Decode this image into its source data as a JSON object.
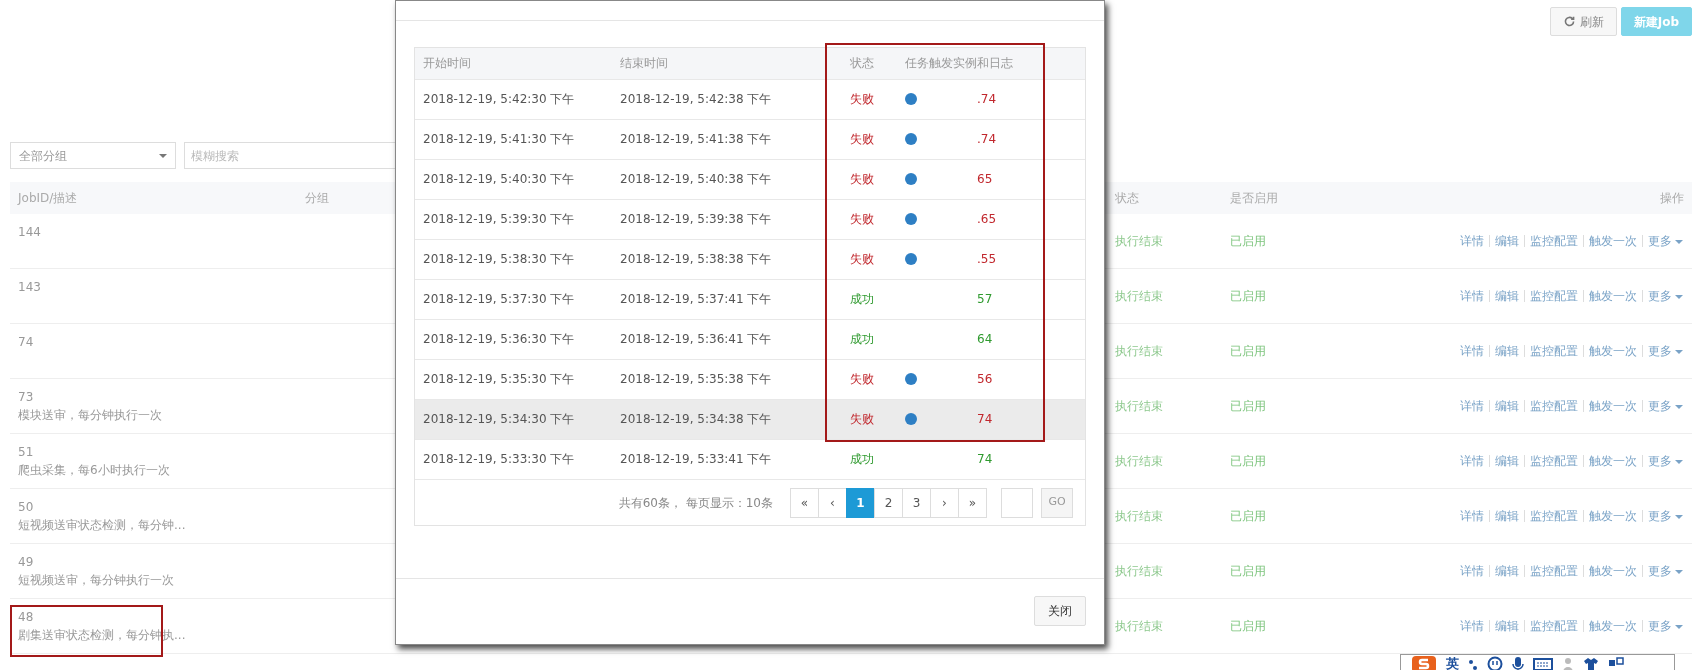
{
  "toolbar": {
    "buttons": [
      {
        "label": "刷新",
        "kind": "refresh"
      },
      {
        "label": "新建Job",
        "kind": "primary"
      }
    ]
  },
  "filters": {
    "group_select": "全部分组",
    "search": {
      "placeholder": "模糊搜索"
    }
  },
  "jobs_table": {
    "columns": [
      "JobID/描述",
      "分组",
      "状态",
      "是否启用",
      "操作"
    ],
    "rows": [
      {
        "id": "144",
        "status": "执行结束",
        "enabled": "已启用",
        "marked": false,
        "actions": [
          "详情",
          "编辑",
          "监控配置",
          "触发一次",
          "更多"
        ]
      },
      {
        "id": "143",
        "status": "执行结束",
        "enabled": "已启用",
        "marked": false,
        "actions": [
          "详情",
          "编辑",
          "监控配置",
          "触发一次",
          "更多"
        ]
      },
      {
        "id": "74",
        "status": "执行结束",
        "enabled": "已启用",
        "marked": false,
        "actions": [
          "详情",
          "编辑",
          "监控配置",
          "触发一次",
          "更多"
        ]
      },
      {
        "id": "73",
        "description": "模块送审，每分钟执行一次",
        "status": "执行结束",
        "enabled": "已启用",
        "marked": false,
        "actions": [
          "详情",
          "编辑",
          "监控配置",
          "触发一次",
          "更多"
        ]
      },
      {
        "id": "51",
        "description": "爬虫采集，每6小时执行一次",
        "status": "执行结束",
        "enabled": "已启用",
        "marked": false,
        "actions": [
          "详情",
          "编辑",
          "监控配置",
          "触发一次",
          "更多"
        ]
      },
      {
        "id": "50",
        "description": "短视频送审状态检测，每分钟...",
        "status": "执行结束",
        "enabled": "已启用",
        "marked": false,
        "actions": [
          "详情",
          "编辑",
          "监控配置",
          "触发一次",
          "更多"
        ]
      },
      {
        "id": "49",
        "description": "短视频送审，每分钟执行一次",
        "status": "执行结束",
        "enabled": "已启用",
        "marked": false,
        "actions": [
          "详情",
          "编辑",
          "监控配置",
          "触发一次",
          "更多"
        ]
      },
      {
        "id": "48",
        "description": "剧集送审状态检测，每分钟执...",
        "status": "执行结束",
        "enabled": "已启用",
        "marked": true,
        "actions": [
          "详情",
          "编辑",
          "监控配置",
          "触发一次",
          "更多"
        ]
      }
    ]
  },
  "modal": {
    "table": {
      "columns": [
        "开始时间",
        "结束时间",
        "状态",
        "任务触发实例和日志"
      ],
      "annotation_box": true,
      "rows": [
        {
          "start": "2018-12-19, 5:42:30 下午",
          "end": "2018-12-19, 5:42:38 下午",
          "status": "失败",
          "color": "#c1272d",
          "info_icon": true,
          "instance": ".74",
          "hovered": false
        },
        {
          "start": "2018-12-19, 5:41:30 下午",
          "end": "2018-12-19, 5:41:38 下午",
          "status": "失败",
          "color": "#c1272d",
          "info_icon": true,
          "instance": ".74",
          "hovered": false
        },
        {
          "start": "2018-12-19, 5:40:30 下午",
          "end": "2018-12-19, 5:40:38 下午",
          "status": "失败",
          "color": "#c1272d",
          "info_icon": true,
          "instance": "65",
          "hovered": false
        },
        {
          "start": "2018-12-19, 5:39:30 下午",
          "end": "2018-12-19, 5:39:38 下午",
          "status": "失败",
          "color": "#c1272d",
          "info_icon": true,
          "instance": ".65",
          "hovered": false
        },
        {
          "start": "2018-12-19, 5:38:30 下午",
          "end": "2018-12-19, 5:38:38 下午",
          "status": "失败",
          "color": "#c1272d",
          "info_icon": true,
          "instance": ".55",
          "hovered": false
        },
        {
          "start": "2018-12-19, 5:37:30 下午",
          "end": "2018-12-19, 5:37:41 下午",
          "status": "成功",
          "color": "#2f9a2f",
          "info_icon": false,
          "instance": "57",
          "hovered": false
        },
        {
          "start": "2018-12-19, 5:36:30 下午",
          "end": "2018-12-19, 5:36:41 下午",
          "status": "成功",
          "color": "#2f9a2f",
          "info_icon": false,
          "instance": "64",
          "hovered": false
        },
        {
          "start": "2018-12-19, 5:35:30 下午",
          "end": "2018-12-19, 5:35:38 下午",
          "status": "失败",
          "color": "#c1272d",
          "info_icon": true,
          "instance": "56",
          "hovered": false
        },
        {
          "start": "2018-12-19, 5:34:30 下午",
          "end": "2018-12-19, 5:34:38 下午",
          "status": "失败",
          "color": "#c1272d",
          "info_icon": true,
          "instance": "74",
          "hovered": true
        },
        {
          "start": "2018-12-19, 5:33:30 下午",
          "end": "2018-12-19, 5:33:41 下午",
          "status": "成功",
          "color": "#2f9a2f",
          "info_icon": false,
          "instance": "74",
          "hovered": false
        }
      ]
    },
    "pager": {
      "total": "共有60条， 每页显示：10条",
      "pages": [
        {
          "label": "«",
          "selected": false
        },
        {
          "label": "‹",
          "selected": false
        },
        {
          "label": "1",
          "selected": true
        },
        {
          "label": "2",
          "selected": false
        },
        {
          "label": "3",
          "selected": false
        },
        {
          "label": "›",
          "selected": false
        },
        {
          "label": "»",
          "selected": false
        }
      ],
      "go": {
        "label": "GO",
        "disabled": true
      }
    },
    "close_button": "关闭"
  },
  "ime_bar": {
    "mode": "英"
  }
}
